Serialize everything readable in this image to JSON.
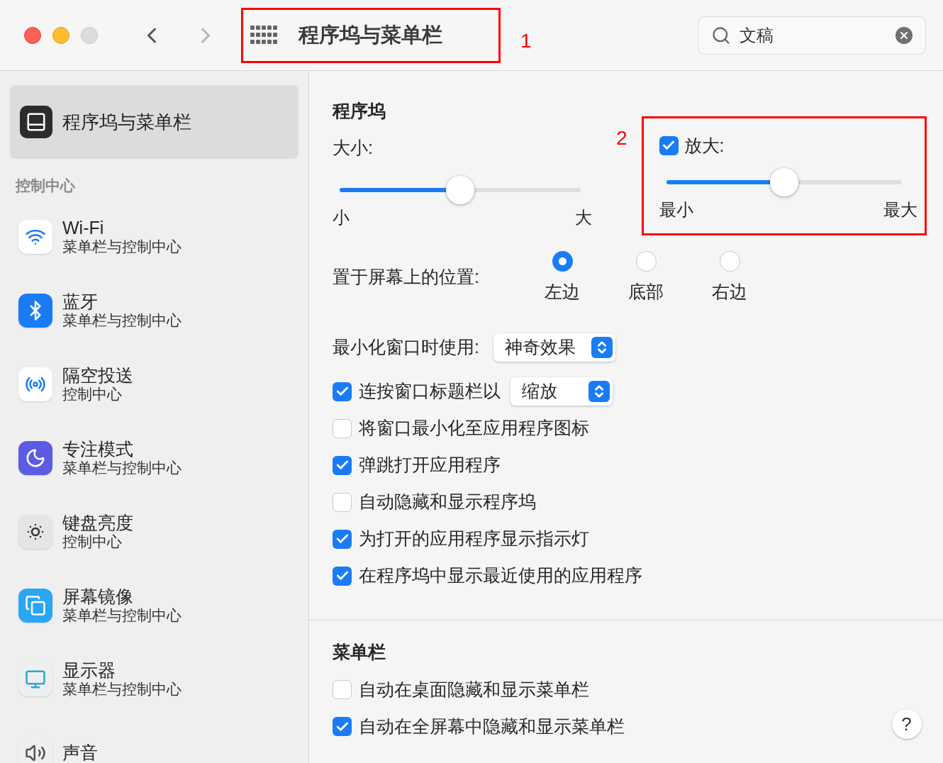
{
  "window": {
    "title": "程序坞与菜单栏",
    "back_disabled": false,
    "forward_disabled": true
  },
  "search": {
    "value": "文稿"
  },
  "annotations": [
    {
      "label": "1"
    },
    {
      "label": "2"
    }
  ],
  "sidebar": {
    "selected_item": {
      "label": "程序坞与菜单栏",
      "selected": true
    },
    "section": "控制中心",
    "items": [
      {
        "kind": "wifi",
        "title": "Wi-Fi",
        "subtitle": "菜单栏与控制中心"
      },
      {
        "kind": "bluetooth",
        "title": "蓝牙",
        "subtitle": "菜单栏与控制中心"
      },
      {
        "kind": "airdrop",
        "title": "隔空投送",
        "subtitle": "控制中心"
      },
      {
        "kind": "focus",
        "title": "专注模式",
        "subtitle": "菜单栏与控制中心"
      },
      {
        "kind": "keyboard",
        "title": "键盘亮度",
        "subtitle": "控制中心"
      },
      {
        "kind": "mirroring",
        "title": "屏幕镜像",
        "subtitle": "菜单栏与控制中心"
      },
      {
        "kind": "display",
        "title": "显示器",
        "subtitle": "菜单栏与控制中心"
      },
      {
        "kind": "sound",
        "title": "声音"
      }
    ]
  },
  "dock": {
    "heading": "程序坞",
    "size": {
      "label": "大小:",
      "level": 0.5,
      "min_label": "小",
      "max_label": "大"
    },
    "magnification": {
      "label": "放大:",
      "checked": true,
      "level": 0.5,
      "min_label": "最小",
      "max_label": "最大"
    },
    "position": {
      "label": "置于屏幕上的位置:",
      "options": [
        {
          "label": "左边",
          "selected": true
        },
        {
          "label": "底部",
          "selected": false
        },
        {
          "label": "右边",
          "selected": false
        }
      ]
    },
    "minimize": {
      "label": "最小化窗口时使用:",
      "value": "神奇效果"
    },
    "double_click": {
      "label": "连按窗口标题栏以",
      "checked": true,
      "value": "缩放"
    },
    "options": [
      {
        "label": "将窗口最小化至应用程序图标",
        "checked": false
      },
      {
        "label": "弹跳打开应用程序",
        "checked": true
      },
      {
        "label": "自动隐藏和显示程序坞",
        "checked": false
      },
      {
        "label": "为打开的应用程序显示指示灯",
        "checked": true
      },
      {
        "label": "在程序坞中显示最近使用的应用程序",
        "checked": true
      }
    ]
  },
  "menu_bar": {
    "heading": "菜单栏",
    "options": [
      {
        "label": "自动在桌面隐藏和显示菜单栏",
        "checked": false
      },
      {
        "label": "自动在全屏幕中隐藏和显示菜单栏",
        "checked": true
      }
    ]
  },
  "help": "?"
}
